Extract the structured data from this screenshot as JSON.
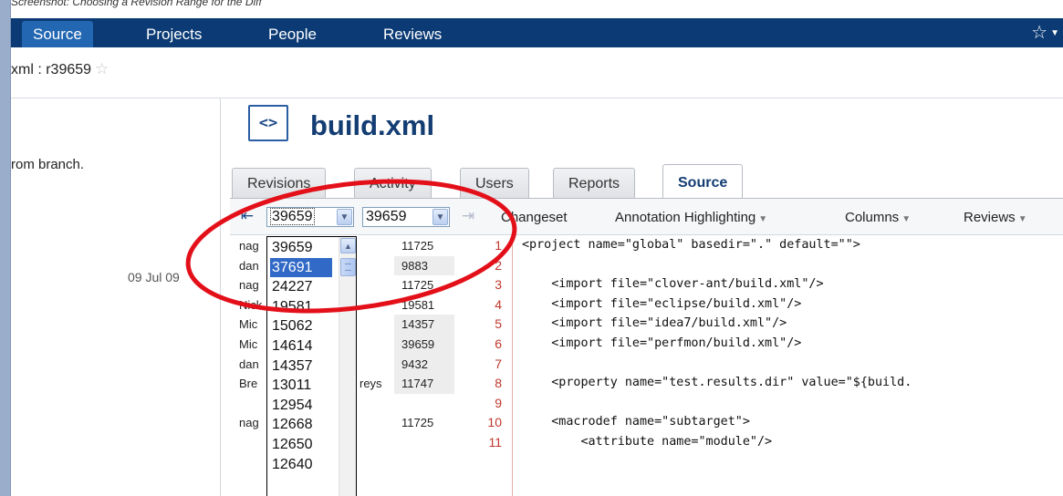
{
  "caption": "Screenshot: Choosing a Revision Range for the Diff",
  "nav": {
    "items": [
      "Source",
      "Projects",
      "People",
      "Reviews"
    ],
    "star": "☆"
  },
  "breadcrumb": {
    "text": "xml : r39659"
  },
  "left_panel": {
    "branch_text": "rom branch.",
    "date": "09 Jul 09"
  },
  "file": {
    "icon_glyph": "<>",
    "title": "build.xml"
  },
  "tabs": [
    "Revisions",
    "Activity",
    "Users",
    "Reports",
    "Source"
  ],
  "toolbar": {
    "from_revision": "39659",
    "to_revision": "39659",
    "changeset": "Changeset",
    "annotation": "Annotation Highlighting",
    "columns": "Columns",
    "reviews": "Reviews"
  },
  "dropdown_options": [
    "39659",
    "37691",
    "24227",
    "19581",
    "15062",
    "14614",
    "14357",
    "13011",
    "12954",
    "12668",
    "12650",
    "12640"
  ],
  "rows": [
    {
      "author": "nag",
      "revision": "11725",
      "line": "1",
      "code": "<project name=\"global\" basedir=\".\" default=\"\">"
    },
    {
      "author": "dan",
      "revision": "9883",
      "line": "2",
      "code": ""
    },
    {
      "author": "nag",
      "revision": "11725",
      "line": "3",
      "code": "    <import file=\"clover-ant/build.xml\"/>"
    },
    {
      "author": "Nick",
      "revision": "19581",
      "line": "4",
      "code": "    <import file=\"eclipse/build.xml\"/>"
    },
    {
      "author": "Mic",
      "revision": "14357",
      "line": "5",
      "code": "    <import file=\"idea7/build.xml\"/>"
    },
    {
      "author": "Mic",
      "revision": "39659",
      "line": "6",
      "code": "    <import file=\"perfmon/build.xml\"/>"
    },
    {
      "author": "dan",
      "revision": "9432",
      "line": "7",
      "code": ""
    },
    {
      "author": "Bre",
      "author_tail": "reys",
      "revision": "11747",
      "line": "8",
      "code": "    <property name=\"test.results.dir\" value=\"${build."
    },
    {
      "author": "",
      "revision": "",
      "line": "9",
      "code": ""
    },
    {
      "author": "nag",
      "revision": "11725",
      "line": "10",
      "code": "    <macrodef name=\"subtarget\">"
    },
    {
      "author": "",
      "revision": "",
      "line": "11",
      "code": "        <attribute name=\"module\"/>"
    }
  ],
  "colors": {
    "nav_bg": "#0b3a74",
    "nav_active": "#2367b3",
    "title": "#133d73",
    "highlight": "#3169c6",
    "annotation_ring": "#e3101a",
    "line_number": "#c0362c"
  }
}
